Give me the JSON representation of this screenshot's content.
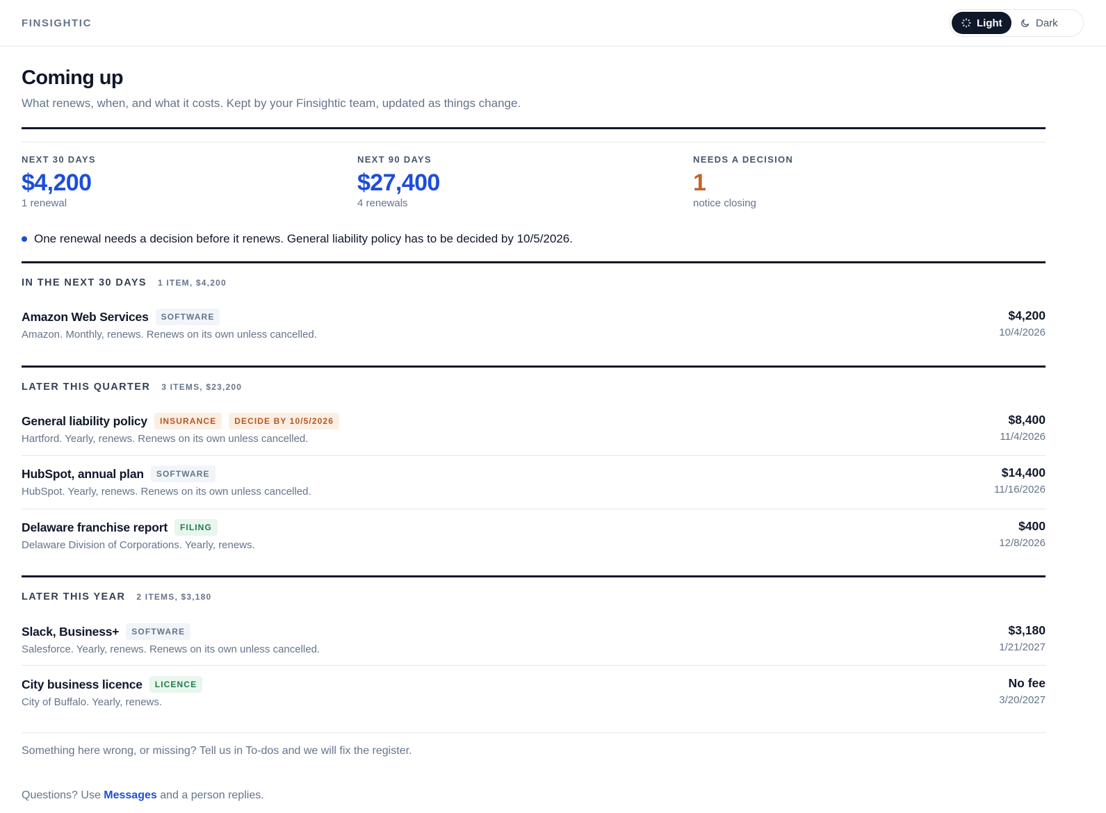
{
  "header": {
    "brand": "FINSIGHTIC",
    "theme": {
      "light_label": "Light",
      "dark_label": "Dark",
      "selected": "Light"
    }
  },
  "page": {
    "title": "Coming up",
    "subtitle": "What renews, when, and what it costs. Kept by your Finsightic team, updated as things change."
  },
  "stats": [
    {
      "label": "NEXT 30 DAYS",
      "value": "$4,200",
      "sub": "1 renewal"
    },
    {
      "label": "NEXT 90 DAYS",
      "value": "$27,400",
      "sub": "4 renewals"
    },
    {
      "label": "NEEDS A DECISION",
      "value": "1",
      "sub": "notice closing"
    }
  ],
  "alert": {
    "text": "One renewal needs a decision before it renews. General liability policy has to be decided by 10/5/2026."
  },
  "groups": [
    {
      "title": "IN THE NEXT 30 DAYS",
      "meta": "1 ITEM, $4,200",
      "items": [
        {
          "name": "Amazon Web Services",
          "badges": [
            "SOFTWARE"
          ],
          "desc": "Amazon. Monthly, renews. Renews on its own unless cancelled.",
          "amount": "$4,200",
          "date": "10/4/2026"
        }
      ]
    },
    {
      "title": "LATER THIS QUARTER",
      "meta": "3 ITEMS, $23,200",
      "items": [
        {
          "name": "General liability policy",
          "badges": [
            "INSURANCE",
            "DECIDE BY 10/5/2026"
          ],
          "desc": "Hartford. Yearly, renews. Renews on its own unless cancelled.",
          "amount": "$8,400",
          "date": "11/4/2026"
        },
        {
          "name": "HubSpot, annual plan",
          "badges": [
            "SOFTWARE"
          ],
          "desc": "HubSpot. Yearly, renews. Renews on its own unless cancelled.",
          "amount": "$14,400",
          "date": "11/16/2026"
        },
        {
          "name": "Delaware franchise report",
          "badges": [
            "FILING"
          ],
          "desc": "Delaware Division of Corporations. Yearly, renews.",
          "amount": "$400",
          "date": "12/8/2026"
        }
      ]
    },
    {
      "title": "LATER THIS YEAR",
      "meta": "2 ITEMS, $3,180",
      "items": [
        {
          "name": "Slack, Business+",
          "badges": [
            "SOFTWARE"
          ],
          "desc": "Salesforce. Yearly, renews. Renews on its own unless cancelled.",
          "amount": "$3,180",
          "date": "1/21/2027"
        },
        {
          "name": "City business licence",
          "badges": [
            "LICENCE"
          ],
          "desc": "City of Buffalo. Yearly, renews.",
          "amount": "No fee",
          "date": "3/20/2027"
        }
      ]
    }
  ],
  "footer": {
    "note": "Something here wrong, or missing? Tell us in To-dos and we will fix the register.",
    "question_prefix": "Questions? Use ",
    "question_link": "Messages",
    "question_suffix": " and a person replies."
  },
  "colors": {
    "accent": "#1d4ed8",
    "warning": "#c2642a",
    "ink": "#0f172a",
    "muted": "#64748b"
  },
  "icons": {
    "light": "sun-icon",
    "dark": "moon-icon"
  }
}
